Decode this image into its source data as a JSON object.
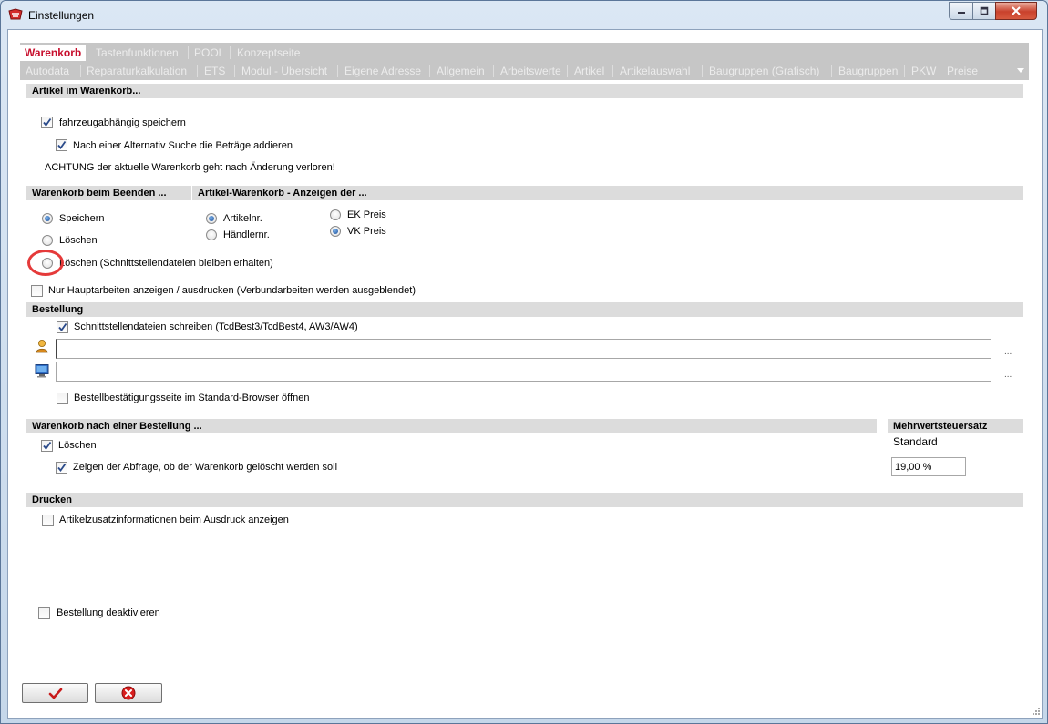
{
  "window": {
    "title": "Einstellungen"
  },
  "tabs": {
    "row1": [
      {
        "label": "Warenkorb",
        "active": true
      },
      {
        "label": "Tastenfunktionen"
      },
      {
        "label": "POOL"
      },
      {
        "label": "Konzeptseite"
      }
    ],
    "row2": [
      {
        "label": "Autodata"
      },
      {
        "label": "Reparaturkalkulation"
      },
      {
        "label": "ETS"
      },
      {
        "label": "Modul - Übersicht"
      },
      {
        "label": "Eigene Adresse"
      },
      {
        "label": "Allgemein"
      },
      {
        "label": "Arbeitswerte"
      },
      {
        "label": "Artikel"
      },
      {
        "label": "Artikelauswahl"
      },
      {
        "label": "Baugruppen (Grafisch)"
      },
      {
        "label": "Baugruppen"
      },
      {
        "label": "PKW"
      },
      {
        "label": "Preise"
      }
    ]
  },
  "artikel": {
    "header": "Artikel im Warenkorb...",
    "fahrzeug": {
      "label": "fahrzeugabhängig speichern",
      "checked": true
    },
    "alternativ": {
      "label": "Nach einer Alternativ Suche die Beträge addieren",
      "checked": true
    },
    "warning": "ACHTUNG der aktuelle Warenkorb geht nach Änderung verloren!"
  },
  "beenden": {
    "header": "Warenkorb beim Beenden ...",
    "options": [
      "Speichern",
      "Löschen",
      "Löschen (Schnittstellendateien bleiben erhalten)"
    ],
    "selected": "Speichern"
  },
  "anzeigen": {
    "header": "Artikel-Warenkorb - Anzeigen der  ...",
    "nummer": {
      "options": [
        "Artikelnr.",
        "Händlernr."
      ],
      "selected": "Artikelnr."
    },
    "preis": {
      "options": [
        "EK Preis",
        "VK Preis"
      ],
      "selected": "VK Preis"
    }
  },
  "hauptarbeiten": {
    "label": "Nur Hauptarbeiten anzeigen / ausdrucken (Verbundarbeiten werden ausgeblendet)",
    "checked": false
  },
  "bestellung": {
    "header": "Bestellung",
    "schnittstelle": {
      "label": "Schnittstellendateien schreiben (TcdBest3/TcdBest4, AW3/AW4)",
      "checked": true
    },
    "field1_value": "",
    "field2_value": "",
    "browse": "...",
    "browser": {
      "label": "Bestellbestätigungsseite im Standard-Browser öffnen",
      "checked": false
    }
  },
  "nach_bestellung": {
    "header": "Warenkorb nach einer Bestellung ...",
    "loeschen": {
      "label": "Löschen",
      "checked": true
    },
    "abfrage": {
      "label": "Zeigen der Abfrage, ob der Warenkorb gelöscht werden soll",
      "checked": true
    }
  },
  "mwst": {
    "header": "Mehrwertsteuersatz",
    "sublabel": "Standard",
    "value": "19,00  %"
  },
  "drucken": {
    "header": "Drucken",
    "zusatz": {
      "label": "Artikelzusatzinformationen beim Ausdruck anzeigen",
      "checked": false
    }
  },
  "deaktivieren": {
    "label": "Bestellung deaktivieren",
    "checked": false
  },
  "colors": {
    "accent_red": "#c8102e",
    "section_bg": "#dcdcdc",
    "tab_bar_bg": "#c6c6c6",
    "radio_blue": "#1c4f9a"
  }
}
